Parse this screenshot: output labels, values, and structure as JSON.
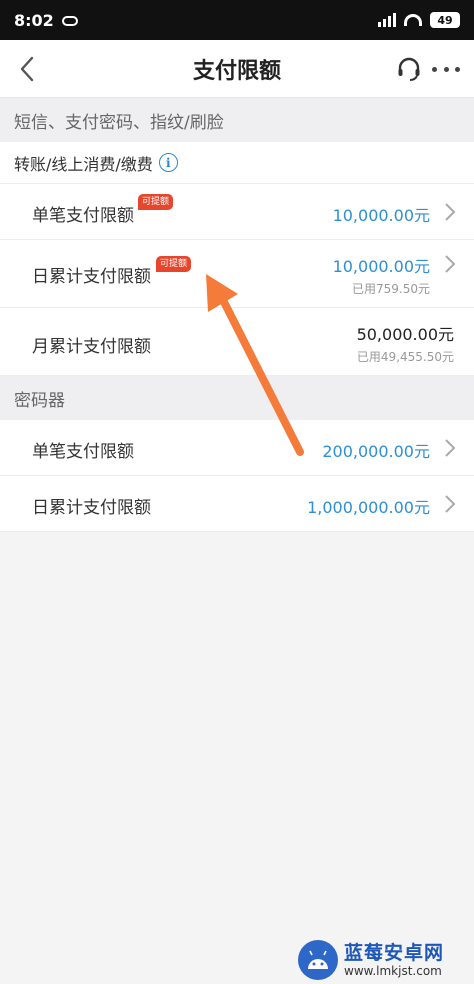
{
  "status_bar": {
    "time": "8:02",
    "battery": "49"
  },
  "nav": {
    "title": "支付限额"
  },
  "sections": {
    "sms": {
      "header": "短信、支付密码、指纹/刷脸",
      "subheader": "转账/线上消费/缴费"
    },
    "token": {
      "header": "密码器"
    }
  },
  "rows": [
    {
      "label": "单笔支付限额",
      "tag": "可提额",
      "value": "10,000.00元"
    },
    {
      "label": "日累计支付限额",
      "tag": "可提额",
      "value": "10,000.00元",
      "used": "已用759.50元"
    },
    {
      "label": "月累计支付限额",
      "value": "50,000.00元",
      "used": "已用49,455.50元"
    },
    {
      "label": "单笔支付限额",
      "value": "200,000.00元"
    },
    {
      "label": "日累计支付限额",
      "value": "1,000,000.00元"
    }
  ],
  "watermark": {
    "title": "蓝莓安卓网",
    "url": "www.lmkjst.com"
  },
  "colors": {
    "accent_blue": "#2e8fd6",
    "tag_red": "#e8462c",
    "arrow_orange": "#f47b3a"
  }
}
